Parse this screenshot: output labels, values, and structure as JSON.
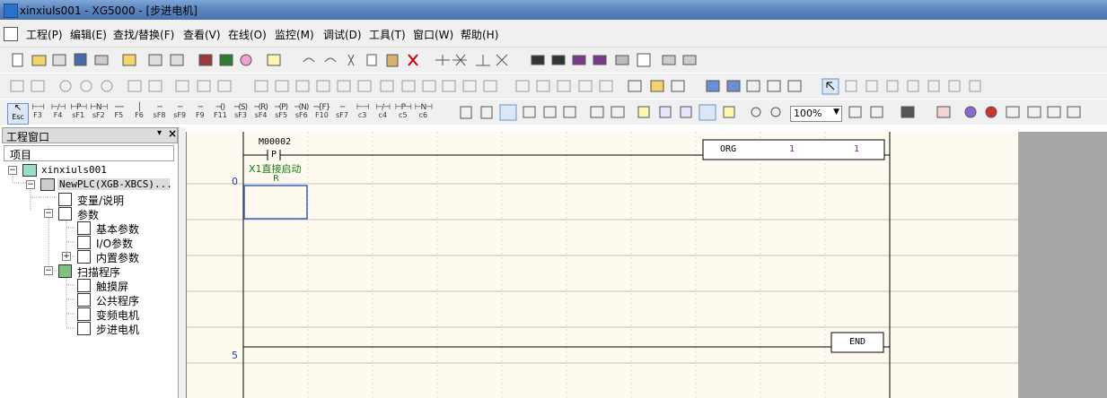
{
  "window": {
    "title": "xinxiuls001 - XG5000 - [步进电机]"
  },
  "menu": [
    "工程(P)",
    "编辑(E)",
    "查找/替换(F)",
    "查看(V)",
    "在线(O)",
    "监控(M)",
    "调试(D)",
    "工具(T)",
    "窗口(W)",
    "帮助(H)"
  ],
  "fkeys": [
    {
      "glyph": "⊢⊣",
      "label": "F3"
    },
    {
      "glyph": "⊢/⊣",
      "label": "F4"
    },
    {
      "glyph": "⊢P⊣",
      "label": "sF1"
    },
    {
      "glyph": "⊢N⊣",
      "label": "sF2"
    },
    {
      "glyph": "──",
      "label": "F5"
    },
    {
      "glyph": "│",
      "label": "F6"
    },
    {
      "glyph": "─",
      "label": "sF8"
    },
    {
      "glyph": "─",
      "label": "sF9"
    },
    {
      "glyph": "─",
      "label": "F9"
    },
    {
      "glyph": "─()",
      "label": "F11"
    },
    {
      "glyph": "─(S)",
      "label": "sF3"
    },
    {
      "glyph": "─(R)",
      "label": "sF4"
    },
    {
      "glyph": "─(P)",
      "label": "sF5"
    },
    {
      "glyph": "─(N)",
      "label": "sF6"
    },
    {
      "glyph": "─{F}",
      "label": "F10"
    },
    {
      "glyph": "─",
      "label": "sF7"
    },
    {
      "glyph": "⊢⊣",
      "label": "c3"
    },
    {
      "glyph": "⊢/⊣",
      "label": "c4"
    },
    {
      "glyph": "⊢P⊣",
      "label": "c5"
    },
    {
      "glyph": "⊢N⊣",
      "label": "c6"
    }
  ],
  "esc_label": "Esc",
  "zoom": "100%",
  "panel": {
    "title": "工程窗口",
    "pin": "▾",
    "close": "×",
    "column": "项目"
  },
  "tree": {
    "project": "xinxiuls001",
    "plc": "NewPLC(XGB-XBCS)...",
    "variables": "变量/说明",
    "params": "参数",
    "basic_params": "基本参数",
    "io_params": "I/O参数",
    "builtin_params": "内置参数",
    "scan": "扫描程序",
    "touch": "触摸屏",
    "common": "公共程序",
    "vfd": "变频电机",
    "stepper": "步进电机"
  },
  "ladder": {
    "row0": "0",
    "row5": "5",
    "contact_addr": "M00002",
    "contact_type": "P",
    "comment": "X1直接启动",
    "coil_label": "R",
    "instr": "ORG",
    "arg1": "1",
    "arg2": "1",
    "end": "END"
  },
  "colors": {
    "row_number": "#1c3ea6",
    "comment": "#1a7a1a",
    "arg": "#8a1a8a",
    "cursor": "#3a5fc0"
  }
}
